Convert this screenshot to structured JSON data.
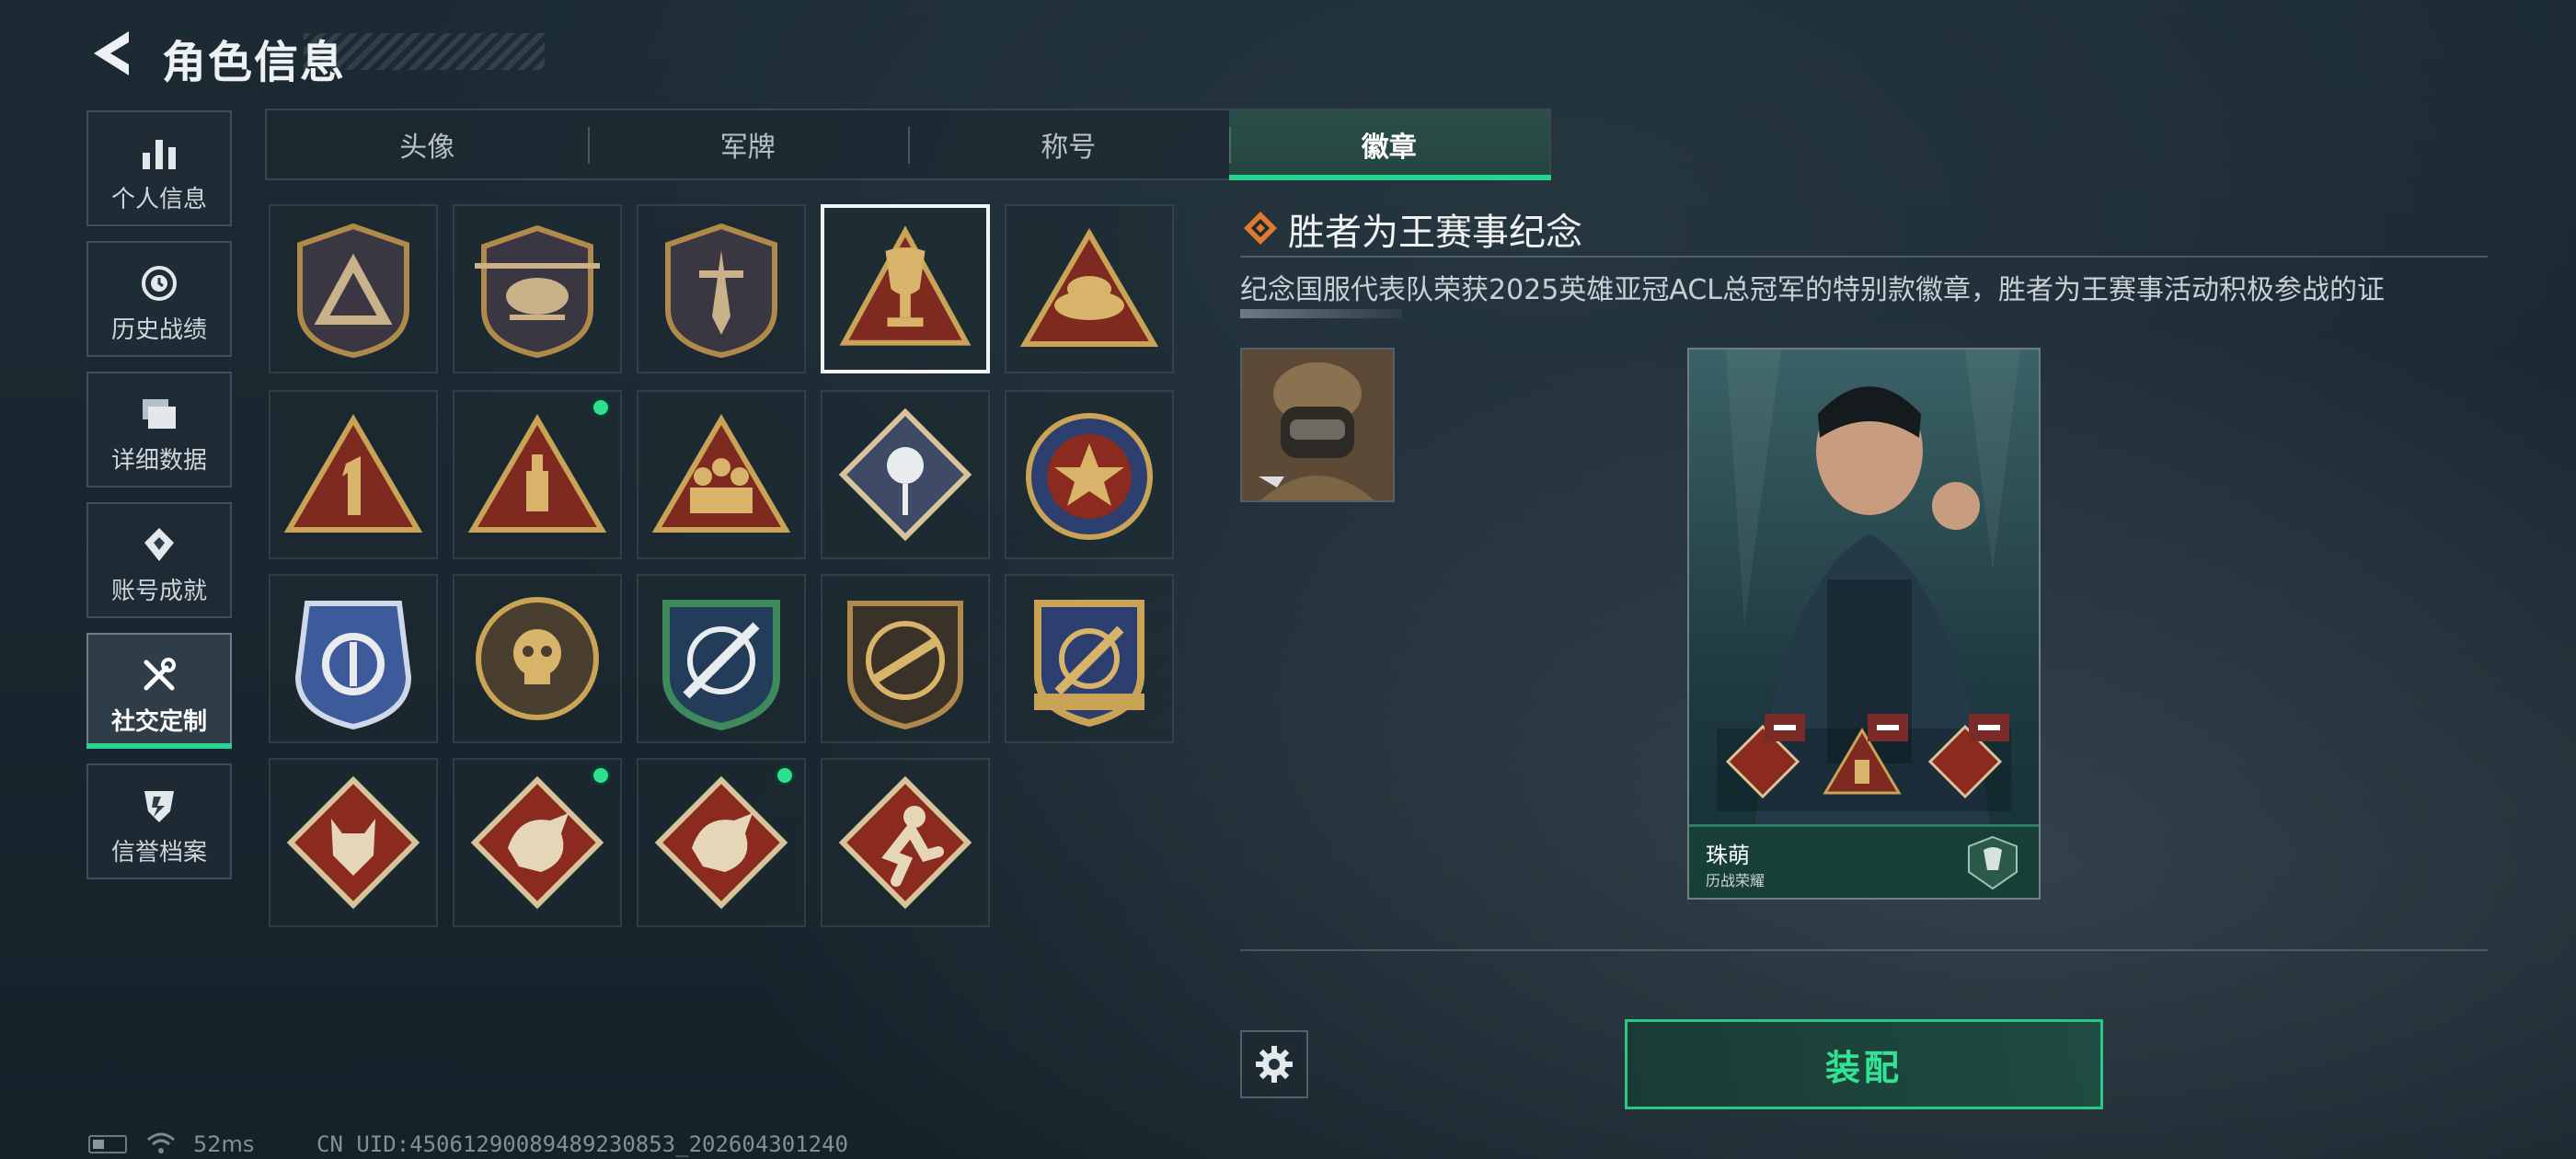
{
  "header": {
    "title": "角色信息"
  },
  "sidebar": {
    "items": [
      {
        "label": "个人信息",
        "icon": "bar-chart-icon"
      },
      {
        "label": "历史战绩",
        "icon": "history-clock-icon"
      },
      {
        "label": "详细数据",
        "icon": "folder-data-icon"
      },
      {
        "label": "账号成就",
        "icon": "achievement-icon"
      },
      {
        "label": "社交定制",
        "icon": "wrench-screwdriver-icon",
        "active": true
      },
      {
        "label": "信誉档案",
        "icon": "credit-shield-icon"
      }
    ]
  },
  "tabs": [
    {
      "label": "头像"
    },
    {
      "label": "军牌"
    },
    {
      "label": "称号"
    },
    {
      "label": "徽章",
      "active": true
    }
  ],
  "badges": [
    {
      "name": "triangle-shield-badge",
      "new": false
    },
    {
      "name": "helicopter-badge",
      "new": false
    },
    {
      "name": "dagger-shield-badge",
      "new": false
    },
    {
      "name": "trophy-badge",
      "new": false,
      "selected": true
    },
    {
      "name": "wings-triangle-badge",
      "new": false
    },
    {
      "name": "number-one-badge",
      "new": false
    },
    {
      "name": "tower-triangle-badge",
      "new": true
    },
    {
      "name": "squad-triangle-badge",
      "new": false
    },
    {
      "name": "rose-diamond-badge",
      "new": false
    },
    {
      "name": "star-emblem-badge",
      "new": false
    },
    {
      "name": "blue-ring-badge",
      "new": false
    },
    {
      "name": "skull-roundel-badge",
      "new": false
    },
    {
      "name": "rifle-crosshair-badge",
      "new": false
    },
    {
      "name": "smg-roundel-badge",
      "new": false
    },
    {
      "name": "gold-crest-badge",
      "new": false
    },
    {
      "name": "wolf-diamond-badge",
      "new": false
    },
    {
      "name": "dragon-diamond-badge",
      "new": true
    },
    {
      "name": "dragon-diamond-badge-2",
      "new": true
    },
    {
      "name": "runner-diamond-badge",
      "new": false
    }
  ],
  "detail": {
    "title": "胜者为王赛事纪念",
    "description": "纪念国服代表队荣获2025英雄亚冠ACL总冠军的特别款徽章，胜者为王赛事活动积极参战的证"
  },
  "card": {
    "name": "珠萌",
    "subtitle": "历战荣耀"
  },
  "actions": {
    "equip_label": "装配"
  },
  "status": {
    "ping": "52ms",
    "uid": "CN UID:45061290089489230853_202604301240"
  },
  "colors": {
    "accent": "#26d38f",
    "badge_red": "#8b2a1f",
    "badge_gold": "#c9a456"
  }
}
